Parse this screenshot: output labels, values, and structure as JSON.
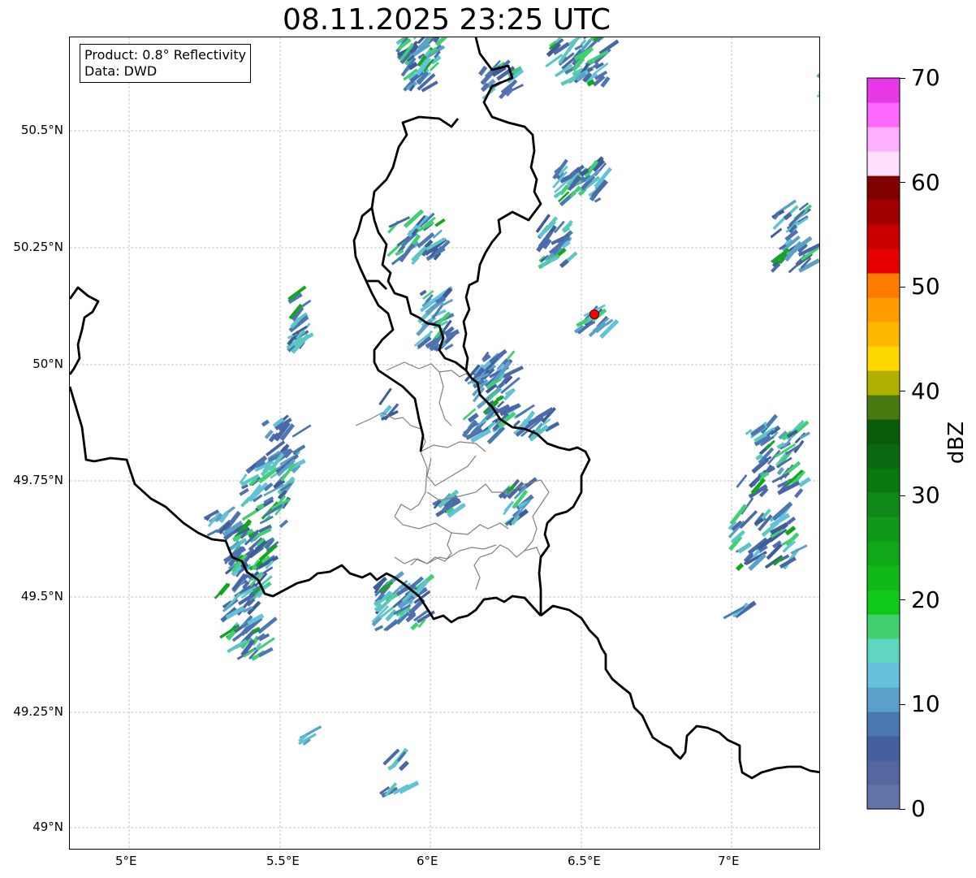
{
  "title": "08.11.2025 23:25 UTC",
  "legend": {
    "product": "Product: 0.8° Reflectivity",
    "source": "Data: DWD"
  },
  "x_ticks": [
    "5°E",
    "5.5°E",
    "6°E",
    "6.5°E",
    "7°E"
  ],
  "y_ticks": [
    "50.5°N",
    "50.25°N",
    "50°N",
    "49.75°N",
    "49.5°N",
    "49.25°N",
    "49°N"
  ],
  "colorbar": {
    "label": "dBZ",
    "ticks": [
      "70",
      "60",
      "50",
      "40",
      "30",
      "20",
      "10",
      "0"
    ],
    "colors": [
      "#6374a8",
      "#5467a0",
      "#4560a0",
      "#4a78b0",
      "#5aa0c8",
      "#66c0dc",
      "#60d6c0",
      "#40d070",
      "#10c818",
      "#10b818",
      "#10a818",
      "#109818",
      "#108818",
      "#0a7810",
      "#0a6810",
      "#0a5a0a",
      "#487810",
      "#b0b000",
      "#ffd800",
      "#ffb800",
      "#ff9c00",
      "#ff7c00",
      "#e80000",
      "#c80000",
      "#a00000",
      "#800000",
      "#ffe0ff",
      "#ffb0ff",
      "#ff68ff",
      "#e838e8"
    ]
  },
  "colors": {
    "radar_low": "#4a6aa8",
    "radar_mid": "#5bbed0",
    "radar_high": "#14c020",
    "border_national": "#000000",
    "border_district": "#808080",
    "radar_site": "#ff0000"
  },
  "icons": {
    "radar_site": "red-circle-marker"
  }
}
